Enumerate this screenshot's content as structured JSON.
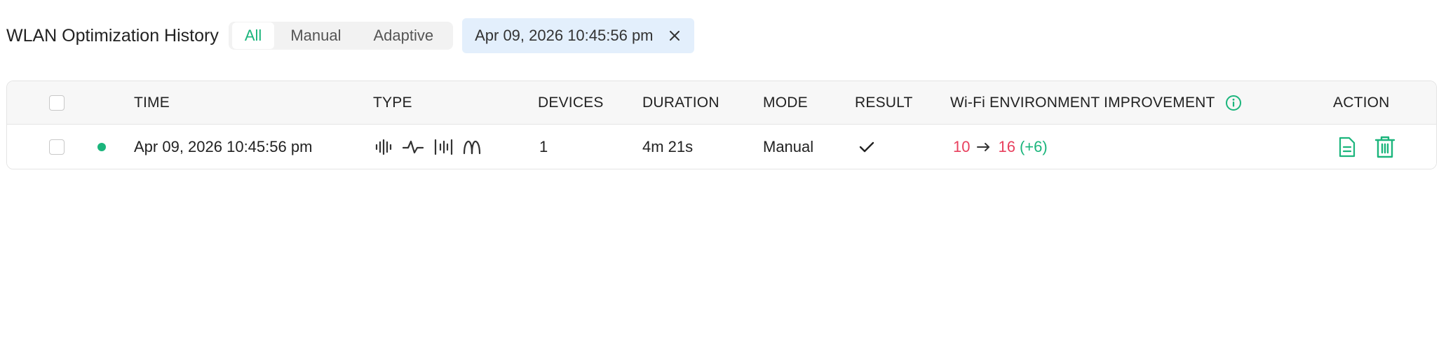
{
  "header": {
    "title": "WLAN Optimization History",
    "filters": [
      {
        "label": "All",
        "active": true
      },
      {
        "label": "Manual",
        "active": false
      },
      {
        "label": "Adaptive",
        "active": false
      }
    ],
    "date_chip": "Apr 09, 2026 10:45:56 pm"
  },
  "table": {
    "columns": {
      "time": "TIME",
      "type": "TYPE",
      "devices": "DEVICES",
      "duration": "DURATION",
      "mode": "MODE",
      "result": "RESULT",
      "improvement": "Wi-Fi ENVIRONMENT IMPROVEMENT",
      "action": "ACTION"
    },
    "rows": [
      {
        "status": "active",
        "time": "Apr 09, 2026 10:45:56 pm",
        "type_icons": [
          "channel-width-icon",
          "waveform-icon",
          "channel-bars-icon",
          "transmit-power-icon"
        ],
        "devices": "1",
        "duration": "4m 21s",
        "mode": "Manual",
        "result": "success",
        "improvement_from": "10",
        "improvement_to": "16",
        "improvement_delta": "(+6)",
        "actions": [
          "view-report-icon",
          "delete-icon"
        ]
      }
    ]
  },
  "colors": {
    "accent": "#1bb57c",
    "score": "#e8405e",
    "chip_bg": "#e3effc"
  }
}
